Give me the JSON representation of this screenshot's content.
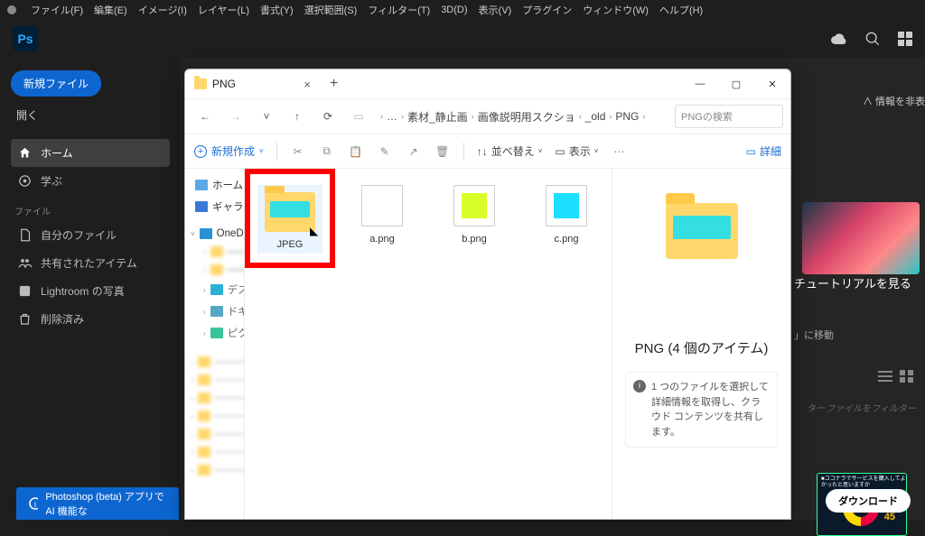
{
  "ps": {
    "menu": [
      "ファイル(F)",
      "編集(E)",
      "イメージ(I)",
      "レイヤー(L)",
      "書式(Y)",
      "選択範囲(S)",
      "フィルター(T)",
      "3D(D)",
      "表示(V)",
      "プラグイン",
      "ウィンドウ(W)",
      "ヘルプ(H)"
    ],
    "logo": "Ps",
    "new_file": "新規ファイル",
    "open": "開く",
    "nav": [
      {
        "label": "ホーム",
        "active": true
      },
      {
        "label": "学ぶ",
        "active": false
      }
    ],
    "files_label": "ファイル",
    "files_nav": [
      {
        "label": "自分のファイル"
      },
      {
        "label": "共有されたアイテム"
      },
      {
        "label": "Lightroom の写真"
      },
      {
        "label": "削除済み"
      }
    ],
    "info_hide": "情報を非表",
    "tutorial": "チュートリアルを見る",
    "move_text": "」に移動",
    "filter_left": "ター",
    "filter_right": "ファイルをフィルター",
    "banner": "Photoshop (beta) アプリで AI 機能な",
    "download": "ダウンロード",
    "survey_text": "■ココナラでサービスを購入してよかったと思いますか",
    "donut_num": "45"
  },
  "explorer": {
    "tab_title": "PNG",
    "breadcrumb": [
      "…",
      "素材_静止画",
      "画像説明用スクショ",
      "_old",
      "PNG"
    ],
    "search_placeholder": "PNGの検索",
    "toolbar": {
      "new": "新規作成",
      "sort": "並べ替え",
      "view": "表示",
      "detail": "詳細"
    },
    "tree": {
      "home": "ホーム",
      "gallery": "ギャラリー",
      "onedrive": "OneDrive",
      "desktop": "デスクトップ",
      "documents": "ドキュメント",
      "pictures": "ピクチャ"
    },
    "items": [
      {
        "name": "JPEG",
        "type": "folder"
      },
      {
        "name": "a.png",
        "type": "file",
        "swatch": "white"
      },
      {
        "name": "b.png",
        "type": "file",
        "swatch": "lime"
      },
      {
        "name": "c.png",
        "type": "file",
        "swatch": "cyan"
      }
    ],
    "side_title": "PNG (4 個のアイテム)",
    "side_hint": "1 つのファイルを選択して詳細情報を取得し、クラウド コンテンツを共有します。"
  }
}
